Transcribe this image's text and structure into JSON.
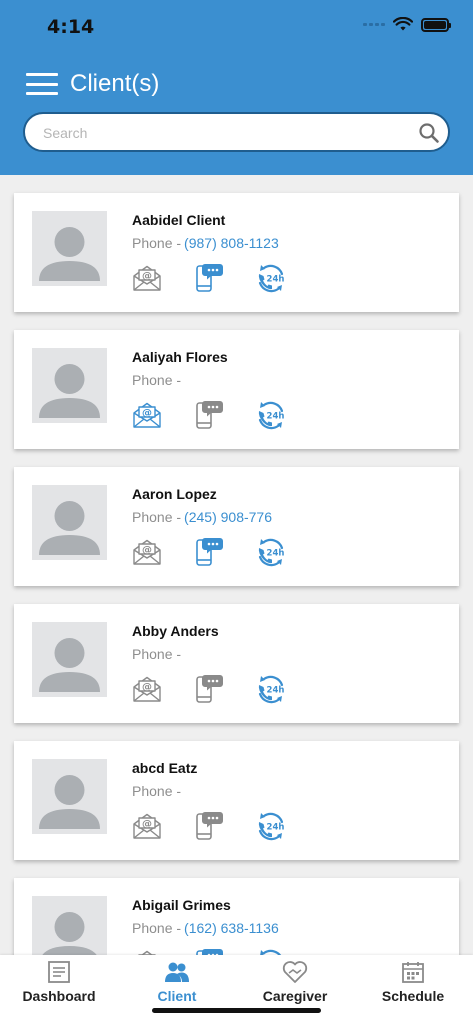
{
  "status_bar": {
    "time": "4:14"
  },
  "header": {
    "title": "Client(s)"
  },
  "search": {
    "placeholder": "Search",
    "value": ""
  },
  "phone_label": "Phone -",
  "clients": [
    {
      "name": "Aabidel Client",
      "phone": "(987) 808-1123",
      "email_active": false,
      "sms_active": true,
      "availability_active": true
    },
    {
      "name": "Aaliyah Flores",
      "phone": "",
      "email_active": true,
      "sms_active": false,
      "availability_active": true
    },
    {
      "name": "Aaron Lopez",
      "phone": "(245) 908-776",
      "email_active": false,
      "sms_active": true,
      "availability_active": true
    },
    {
      "name": "Abby Anders",
      "phone": "",
      "email_active": false,
      "sms_active": false,
      "availability_active": true
    },
    {
      "name": "abcd Eatz",
      "phone": "",
      "email_active": false,
      "sms_active": false,
      "availability_active": true
    },
    {
      "name": "Abigail Grimes",
      "phone": "(162) 638-1136",
      "email_active": false,
      "sms_active": true,
      "availability_active": true
    }
  ],
  "bottom_nav": {
    "tabs": [
      {
        "label": "Dashboard",
        "icon": "dashboard-icon",
        "active": false
      },
      {
        "label": "Client",
        "icon": "client-icon",
        "active": true
      },
      {
        "label": "Caregiver",
        "icon": "caregiver-icon",
        "active": false
      },
      {
        "label": "Schedule",
        "icon": "schedule-icon",
        "active": false
      }
    ]
  },
  "colors": {
    "header_blue": "#3b8fd0",
    "link_blue": "#3b8fd0",
    "icon_gray": "#8a8a8a",
    "avatar_bg": "#e3e4e6",
    "avatar_fg": "#abafb3"
  }
}
